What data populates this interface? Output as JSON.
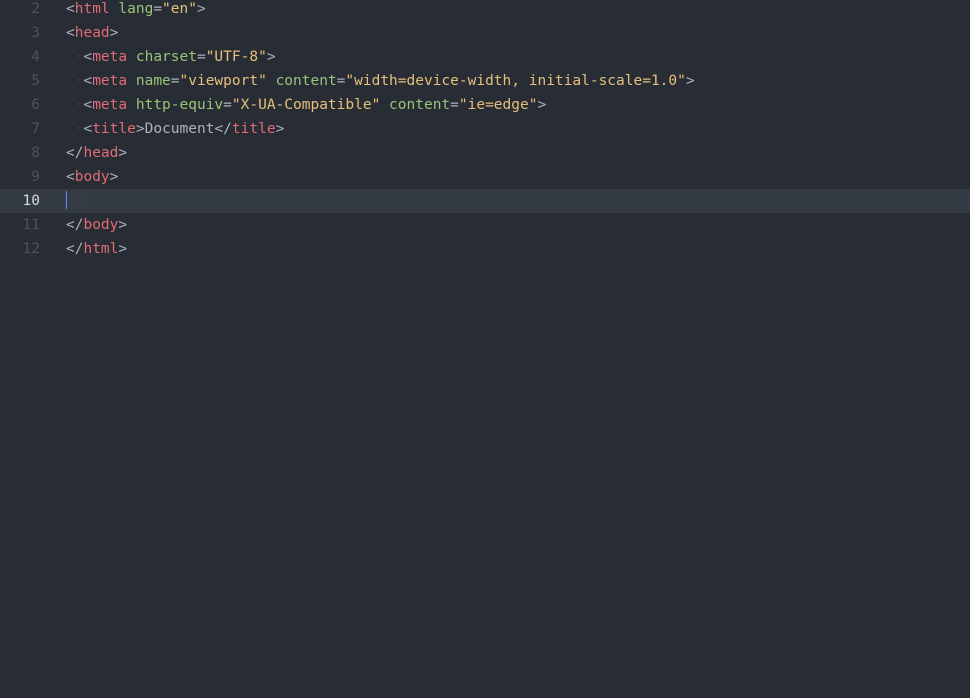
{
  "colors": {
    "background": "#282c34",
    "active_line": "#353b45",
    "gutter": "#4b5263",
    "gutter_active": "#d7dae0",
    "tag": "#e06c75",
    "attribute": "#98c379",
    "string": "#e5c07b",
    "punctuation": "#abb2bf",
    "cursor": "#528bff"
  },
  "lines": [
    {
      "num": "2",
      "indent": "",
      "tokens": [
        {
          "t": "punct",
          "v": "<"
        },
        {
          "t": "tag",
          "v": "html"
        },
        {
          "t": "punct",
          "v": " "
        },
        {
          "t": "attr",
          "v": "lang"
        },
        {
          "t": "punct",
          "v": "="
        },
        {
          "t": "str",
          "v": "\"en\""
        },
        {
          "t": "punct",
          "v": ">"
        }
      ]
    },
    {
      "num": "3",
      "indent": "",
      "tokens": [
        {
          "t": "punct",
          "v": "<"
        },
        {
          "t": "tag",
          "v": "head"
        },
        {
          "t": "punct",
          "v": ">"
        }
      ]
    },
    {
      "num": "4",
      "indent": "··",
      "tokens": [
        {
          "t": "punct",
          "v": "<"
        },
        {
          "t": "tag",
          "v": "meta"
        },
        {
          "t": "punct",
          "v": " "
        },
        {
          "t": "attr",
          "v": "charset"
        },
        {
          "t": "punct",
          "v": "="
        },
        {
          "t": "str",
          "v": "\"UTF-8\""
        },
        {
          "t": "punct",
          "v": ">"
        }
      ]
    },
    {
      "num": "5",
      "indent": "··",
      "tokens": [
        {
          "t": "punct",
          "v": "<"
        },
        {
          "t": "tag",
          "v": "meta"
        },
        {
          "t": "punct",
          "v": " "
        },
        {
          "t": "attr",
          "v": "name"
        },
        {
          "t": "punct",
          "v": "="
        },
        {
          "t": "str",
          "v": "\"viewport\""
        },
        {
          "t": "punct",
          "v": " "
        },
        {
          "t": "attr",
          "v": "content"
        },
        {
          "t": "punct",
          "v": "="
        },
        {
          "t": "str",
          "v": "\"width=device-width, initial-scale=1.0\""
        },
        {
          "t": "punct",
          "v": ">"
        }
      ]
    },
    {
      "num": "6",
      "indent": "··",
      "tokens": [
        {
          "t": "punct",
          "v": "<"
        },
        {
          "t": "tag",
          "v": "meta"
        },
        {
          "t": "punct",
          "v": " "
        },
        {
          "t": "attr",
          "v": "http-equiv"
        },
        {
          "t": "punct",
          "v": "="
        },
        {
          "t": "str",
          "v": "\"X-UA-Compatible\""
        },
        {
          "t": "punct",
          "v": " "
        },
        {
          "t": "attr",
          "v": "content"
        },
        {
          "t": "punct",
          "v": "="
        },
        {
          "t": "str",
          "v": "\"ie=edge\""
        },
        {
          "t": "punct",
          "v": ">"
        }
      ]
    },
    {
      "num": "7",
      "indent": "··",
      "tokens": [
        {
          "t": "punct",
          "v": "<"
        },
        {
          "t": "tag",
          "v": "title"
        },
        {
          "t": "punct",
          "v": ">"
        },
        {
          "t": "text",
          "v": "Document"
        },
        {
          "t": "punct",
          "v": "</"
        },
        {
          "t": "tag",
          "v": "title"
        },
        {
          "t": "punct",
          "v": ">"
        }
      ]
    },
    {
      "num": "8",
      "indent": "",
      "tokens": [
        {
          "t": "punct",
          "v": "</"
        },
        {
          "t": "tag",
          "v": "head"
        },
        {
          "t": "punct",
          "v": ">"
        }
      ]
    },
    {
      "num": "9",
      "indent": "",
      "tokens": [
        {
          "t": "punct",
          "v": "<"
        },
        {
          "t": "tag",
          "v": "body"
        },
        {
          "t": "punct",
          "v": ">"
        }
      ]
    },
    {
      "num": "10",
      "indent": "··",
      "active": true,
      "tokens": []
    },
    {
      "num": "11",
      "indent": "",
      "tokens": [
        {
          "t": "punct",
          "v": "</"
        },
        {
          "t": "tag",
          "v": "body"
        },
        {
          "t": "punct",
          "v": ">"
        }
      ]
    },
    {
      "num": "12",
      "indent": "",
      "tokens": [
        {
          "t": "punct",
          "v": "</"
        },
        {
          "t": "tag",
          "v": "html"
        },
        {
          "t": "punct",
          "v": ">"
        }
      ]
    }
  ]
}
